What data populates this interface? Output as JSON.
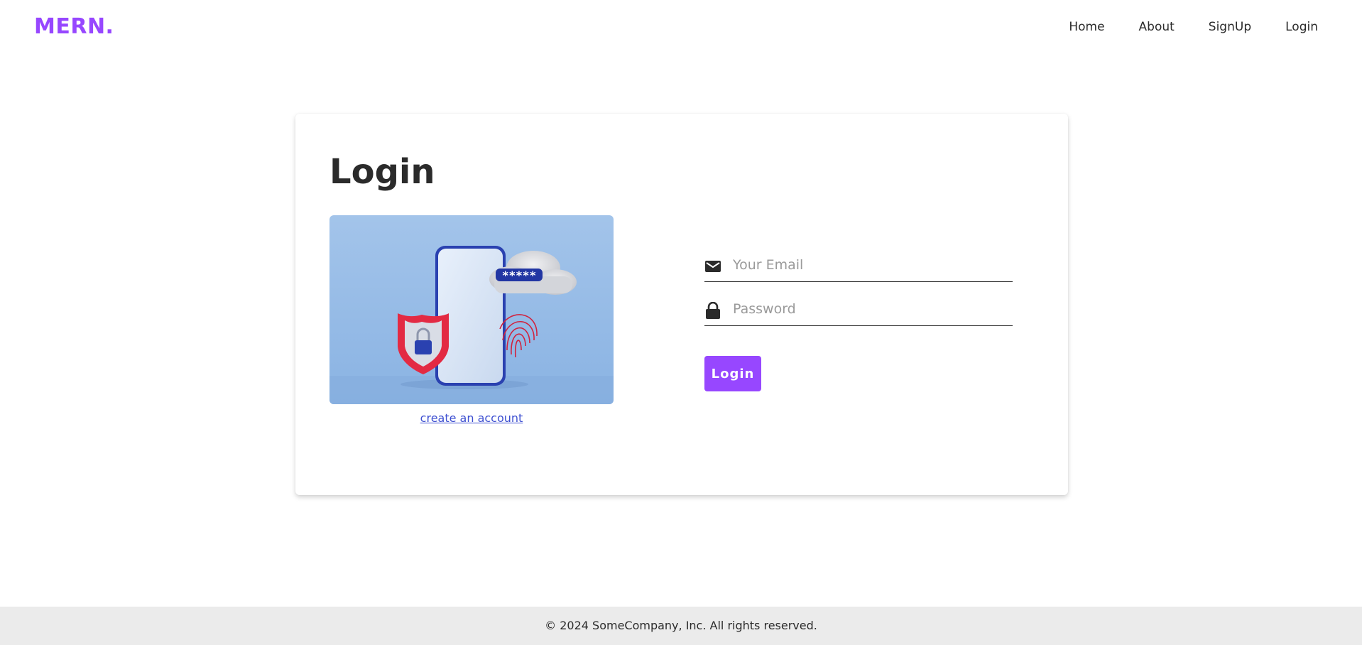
{
  "brand": {
    "name": "MERN."
  },
  "nav": {
    "links": [
      "Home",
      "About",
      "SignUp",
      "Login"
    ]
  },
  "login": {
    "title": "Login",
    "illustration": {
      "password_mask": "*****"
    },
    "create_account_link": "create an account",
    "email": {
      "placeholder": "Your Email",
      "value": "",
      "icon": "email-icon"
    },
    "password": {
      "placeholder": "Password",
      "value": "",
      "icon": "lock-icon"
    },
    "submit_label": "Login"
  },
  "footer": {
    "copyright": "© 2024 SomeCompany, Inc. All rights reserved."
  },
  "colors": {
    "accent": "#9747ff",
    "link": "#3d4fd1",
    "text": "#2b2b2b",
    "footer_bg": "#ebebeb"
  }
}
